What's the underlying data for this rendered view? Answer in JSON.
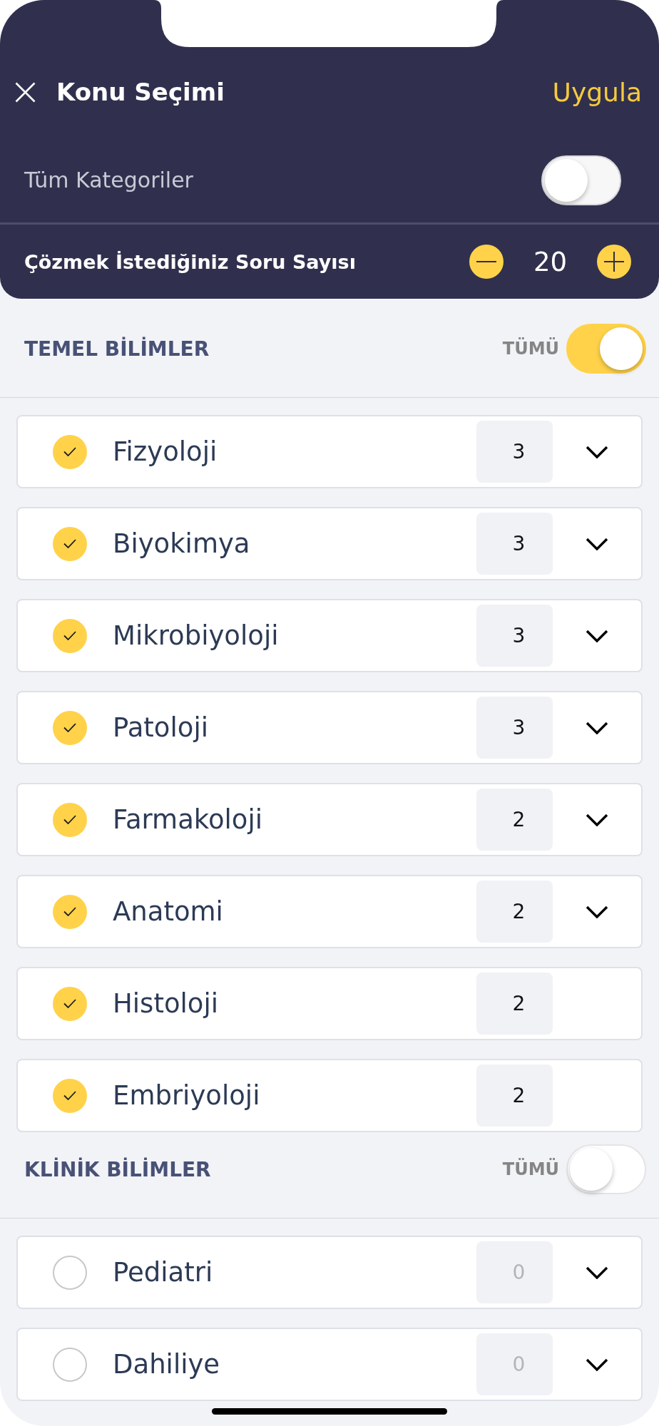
{
  "header": {
    "title": "Konu Seçimi",
    "action": "Uygula",
    "all_categories": {
      "label": "Tüm Kategoriler",
      "on": false
    },
    "question_count": {
      "label": "Çözmek İstediğiniz Soru Sayısı",
      "value": "20"
    }
  },
  "sections": [
    {
      "title": "TEMEL BİLİMLER",
      "all_label": "TÜMÜ",
      "all_on": true,
      "topics": [
        {
          "name": "Fizyoloji",
          "checked": true,
          "count": "3",
          "expandable": true
        },
        {
          "name": "Biyokimya",
          "checked": true,
          "count": "3",
          "expandable": true
        },
        {
          "name": "Mikrobiyoloji",
          "checked": true,
          "count": "3",
          "expandable": true
        },
        {
          "name": "Patoloji",
          "checked": true,
          "count": "3",
          "expandable": true
        },
        {
          "name": "Farmakoloji",
          "checked": true,
          "count": "2",
          "expandable": true
        },
        {
          "name": "Anatomi",
          "checked": true,
          "count": "2",
          "expandable": true
        },
        {
          "name": "Histoloji",
          "checked": true,
          "count": "2",
          "expandable": false
        },
        {
          "name": "Embriyoloji",
          "checked": true,
          "count": "2",
          "expandable": false
        }
      ]
    },
    {
      "title": "KLİNİK BİLİMLER",
      "all_label": "TÜMÜ",
      "all_on": false,
      "topics": [
        {
          "name": "Pediatri",
          "checked": false,
          "count": "0",
          "expandable": true
        },
        {
          "name": "Dahiliye",
          "checked": false,
          "count": "0",
          "expandable": true
        }
      ]
    }
  ]
}
